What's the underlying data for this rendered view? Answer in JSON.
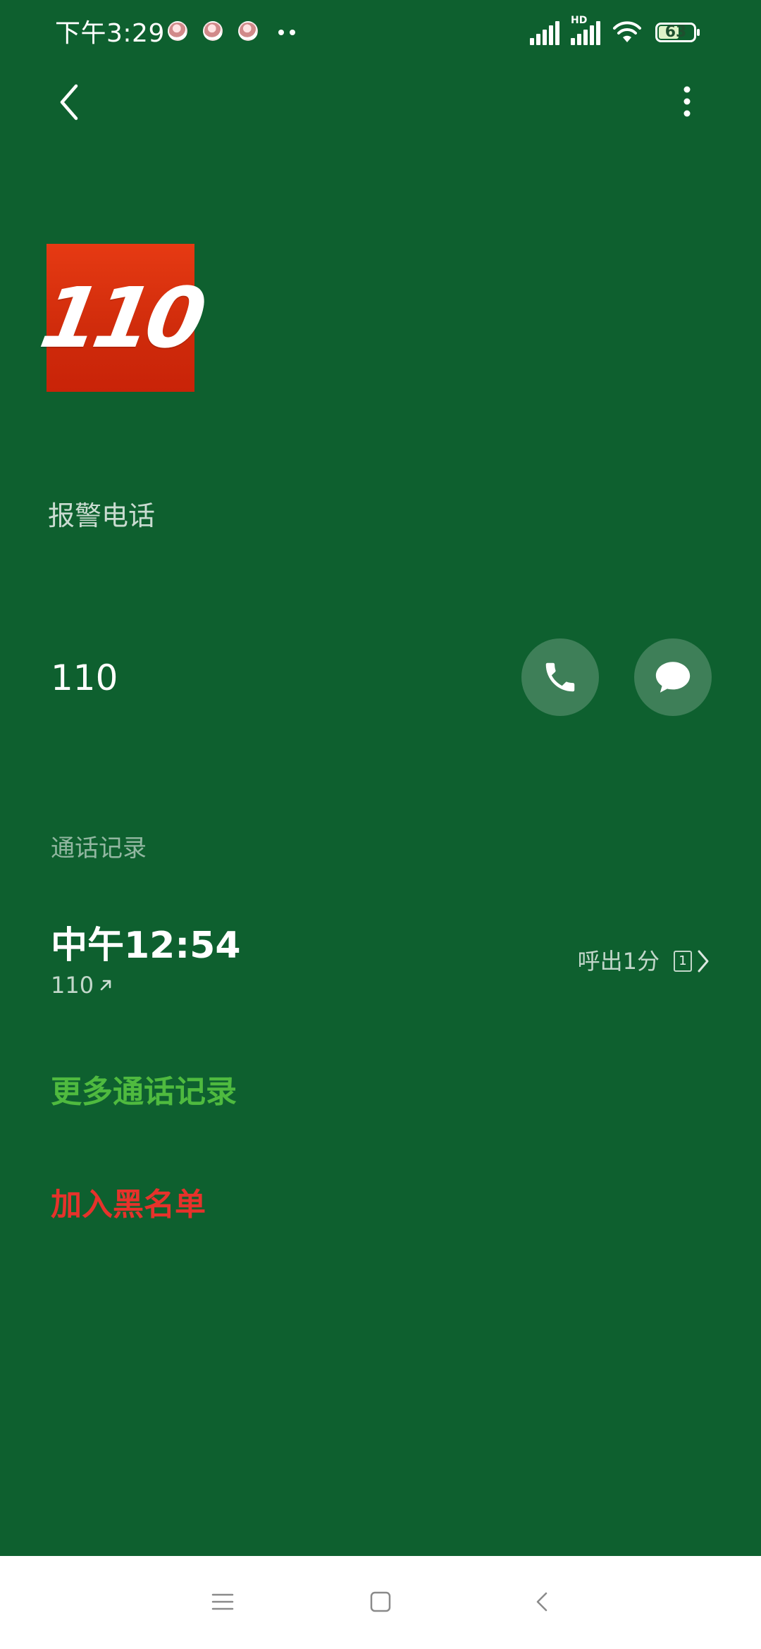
{
  "status_bar": {
    "time": "下午3:29",
    "battery_level": 63,
    "battery_label": "63",
    "signal_label": "HD",
    "notification_icons": [
      "avatar-icon",
      "avatar-icon",
      "avatar-icon"
    ]
  },
  "top_bar": {
    "back_icon": "chevron-left-icon",
    "menu_icon": "more-vertical-icon"
  },
  "contact": {
    "avatar_text": "110",
    "name": "报警电话",
    "number": "110",
    "actions": {
      "call_icon": "phone-icon",
      "message_icon": "chat-icon"
    }
  },
  "call_log": {
    "title": "通话记录",
    "entries": [
      {
        "time": "中午12:54",
        "number": "110",
        "direction_icon": "outgoing-arrow-icon",
        "type_duration": "呼出1分",
        "sim": "1",
        "chevron_icon": "chevron-right-icon"
      }
    ],
    "more_records": "更多通话记录",
    "blacklist": "加入黑名单"
  },
  "colors": {
    "background": "#0e602f",
    "accent_green": "#4fba3f",
    "danger_red": "#e6322b",
    "avatar_red": "#d52b0c",
    "nav_bar": "#ffffff"
  },
  "nav_bar": {
    "menu_icon": "menu-icon",
    "home_icon": "square-icon",
    "back_icon": "chevron-left-icon"
  }
}
